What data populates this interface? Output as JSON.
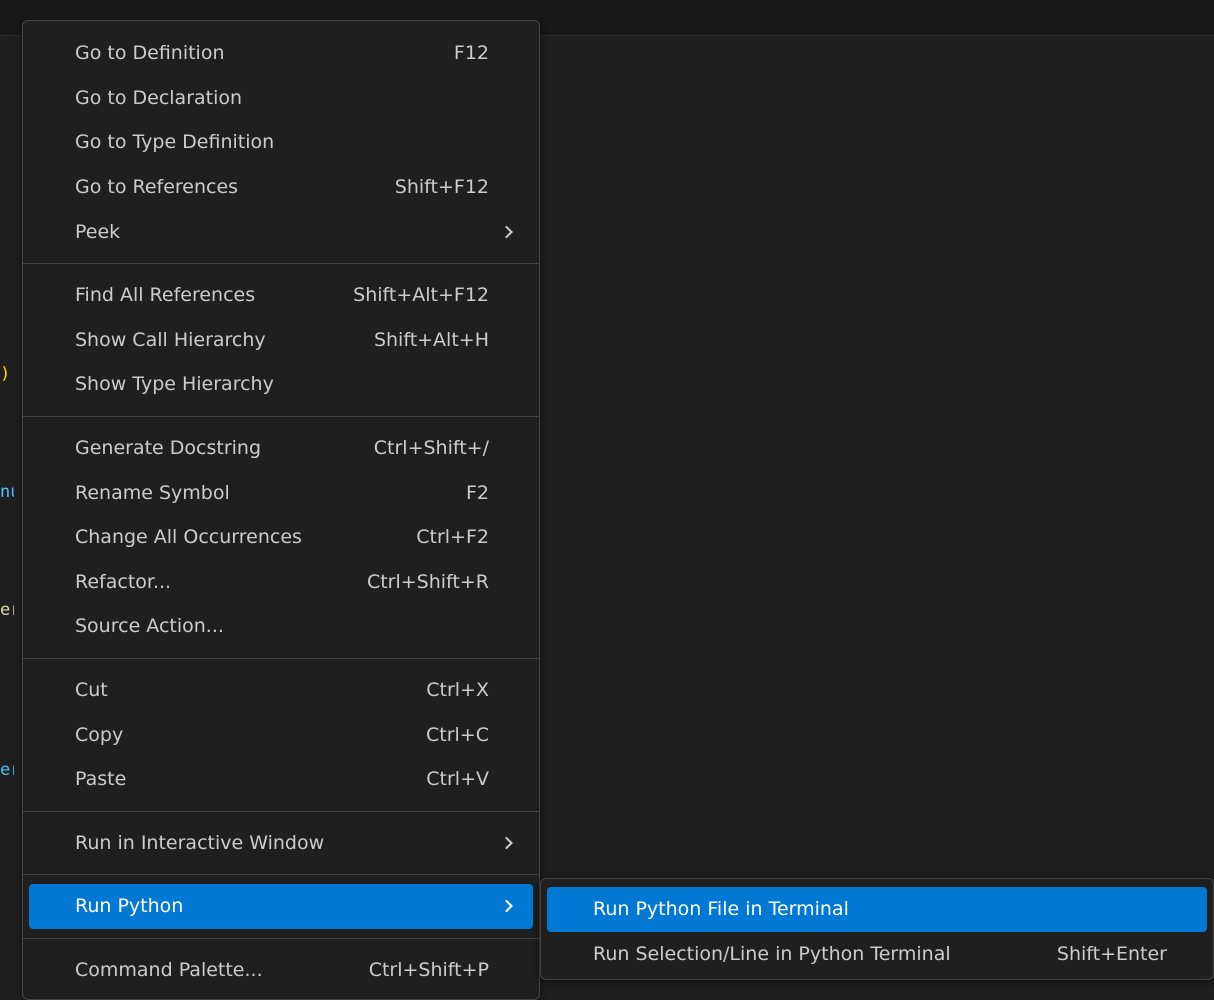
{
  "colors": {
    "menu_background": "#1f1f1f",
    "menu_border": "#454545",
    "highlight": "#0078d4",
    "text": "#cccccc"
  },
  "menu": {
    "groups": [
      [
        {
          "label": "Go to Definition",
          "shortcut": "F12"
        },
        {
          "label": "Go to Declaration",
          "shortcut": ""
        },
        {
          "label": "Go to Type Definition",
          "shortcut": ""
        },
        {
          "label": "Go to References",
          "shortcut": "Shift+F12"
        },
        {
          "label": "Peek",
          "shortcut": "",
          "submenu": true
        }
      ],
      [
        {
          "label": "Find All References",
          "shortcut": "Shift+Alt+F12"
        },
        {
          "label": "Show Call Hierarchy",
          "shortcut": "Shift+Alt+H"
        },
        {
          "label": "Show Type Hierarchy",
          "shortcut": ""
        }
      ],
      [
        {
          "label": "Generate Docstring",
          "shortcut": "Ctrl+Shift+/"
        },
        {
          "label": "Rename Symbol",
          "shortcut": "F2"
        },
        {
          "label": "Change All Occurrences",
          "shortcut": "Ctrl+F2"
        },
        {
          "label": "Refactor...",
          "shortcut": "Ctrl+Shift+R"
        },
        {
          "label": "Source Action...",
          "shortcut": ""
        }
      ],
      [
        {
          "label": "Cut",
          "shortcut": "Ctrl+X"
        },
        {
          "label": "Copy",
          "shortcut": "Ctrl+C"
        },
        {
          "label": "Paste",
          "shortcut": "Ctrl+V"
        }
      ],
      [
        {
          "label": "Run in Interactive Window",
          "shortcut": "",
          "submenu": true
        }
      ],
      [
        {
          "label": "Run Python",
          "shortcut": "",
          "submenu": true,
          "active": true
        }
      ],
      [
        {
          "label": "Command Palette...",
          "shortcut": "Ctrl+Shift+P"
        }
      ]
    ]
  },
  "submenu": {
    "items": [
      {
        "label": "Run Python File in Terminal",
        "shortcut": "",
        "active": true
      },
      {
        "label": "Run Selection/Line in Python Terminal",
        "shortcut": "Shift+Enter"
      }
    ]
  },
  "editor_gutter": [
    {
      "text": ")",
      "color": "#ffd700"
    },
    {
      "text": "nu",
      "color": "#4fc1ff"
    },
    {
      "text": "er",
      "color": "#dcdcaa"
    },
    {
      "text": "er",
      "color": "#4fc1ff"
    }
  ]
}
